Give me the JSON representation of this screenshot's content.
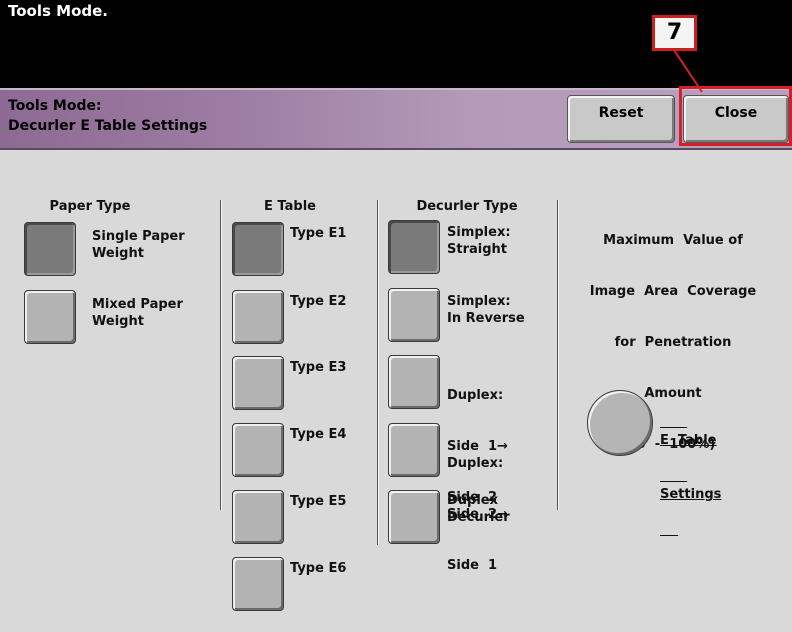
{
  "topbar": {
    "title": "Tools Mode."
  },
  "header": {
    "line1": "Tools Mode:",
    "line2": "Decurler E Table Settings",
    "reset_label": "Reset",
    "close_label": "Close"
  },
  "callout": {
    "number": "7",
    "color": "#d81f26"
  },
  "paper_type": {
    "heading": "Paper Type",
    "options": [
      {
        "line1": "Single Paper",
        "line2": "Weight",
        "selected": true
      },
      {
        "line1": "Mixed Paper",
        "line2": "Weight",
        "selected": false
      }
    ]
  },
  "e_table": {
    "heading": "E Table",
    "options": [
      {
        "label": "Type E1",
        "selected": true
      },
      {
        "label": "Type E2",
        "selected": false
      },
      {
        "label": "Type E3",
        "selected": false
      },
      {
        "label": "Type E4",
        "selected": false
      },
      {
        "label": "Type E5",
        "selected": false
      },
      {
        "label": "Type E6",
        "selected": false
      }
    ]
  },
  "decurler_type": {
    "heading": "Decurler Type",
    "options": [
      {
        "line1": "Simplex:",
        "line2": "Straight",
        "line3": "",
        "selected": true
      },
      {
        "line1": "Simplex:",
        "line2": "In Reverse",
        "line3": "",
        "selected": false
      },
      {
        "line1": "Duplex:",
        "line2": "Side  1→",
        "line3": "Side  2",
        "selected": false
      },
      {
        "line1": "Duplex:",
        "line2": "Side  2→",
        "line3": "Side  1",
        "selected": false
      },
      {
        "line1": "Duplex",
        "line2": "Decurler",
        "line3": "",
        "selected": false
      }
    ]
  },
  "max_value": {
    "line1": "Maximum  Value of",
    "line2": "Image  Area  Coverage",
    "line3": "for  Penetration",
    "line4": "Amount",
    "line5": "(0  -  100%)",
    "button_line1": "E  Table",
    "button_line2": "Settings"
  }
}
